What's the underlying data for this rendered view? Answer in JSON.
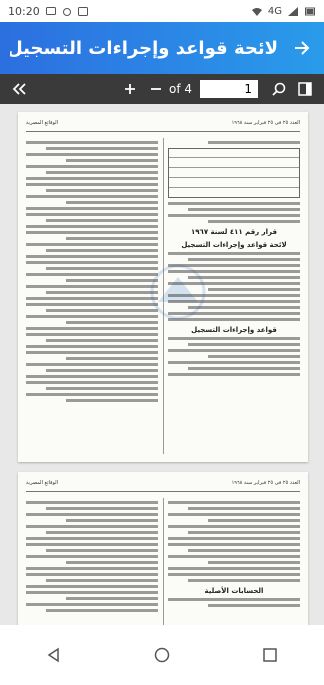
{
  "status_bar": {
    "time": "10:20",
    "network": "4G"
  },
  "app_bar": {
    "title": "لائحة قواعد وإجراءات التسجيل بالمؤ...",
    "back_icon": "arrow-right-icon"
  },
  "toolbar": {
    "page_of": "of 4",
    "current_page": "1"
  },
  "document": {
    "page1_heading_1": "قرار رقم ٤١١ لسنة ١٩٦٧",
    "page1_heading_2": "لائحة قواعد وإجراءات التسجيل",
    "page1_heading_3": "قواعد وإجراءات التسجيل",
    "page1_header_left": "الوقائع المصرية",
    "page1_header_right": "العدد ٢٥ فى ٢٥ فبراير سنة ١٩٦٨",
    "page2_header_left": "الوقائع المصرية",
    "page2_header_right": "العدد ٢٥ فى ٢٥ فبراير سنة ١٩٦٨",
    "page2_heading_1": "الحسابات الأصلية"
  },
  "colors": {
    "appbar_start": "#2c6fe0",
    "appbar_end": "#2a9bea",
    "toolbar": "#3a3a3a"
  }
}
